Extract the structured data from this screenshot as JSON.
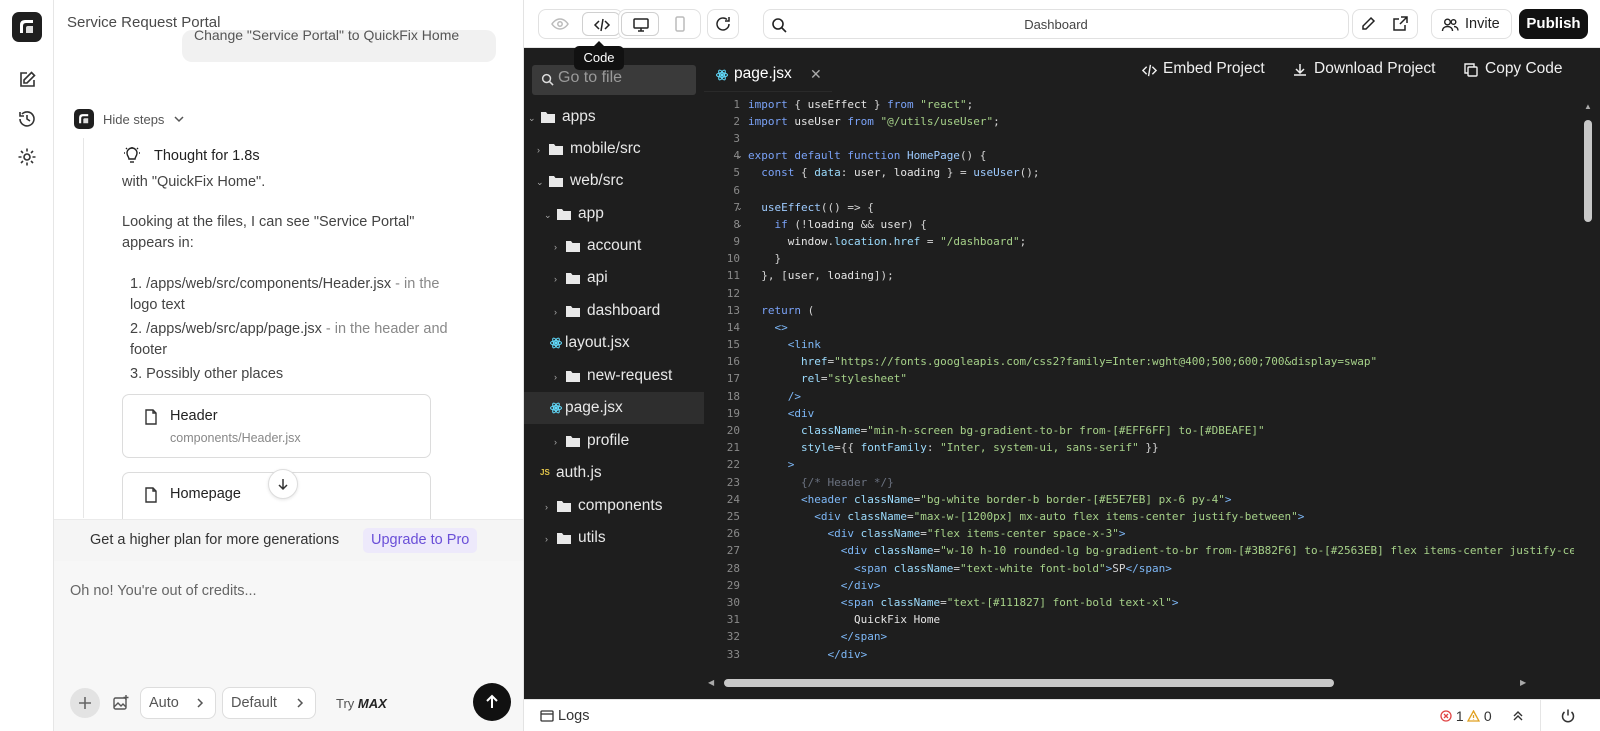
{
  "colors": {
    "accent": "#6a4fd8",
    "editor_bg": "#1e1e1e",
    "publish_bg": "#111111"
  },
  "rail": {
    "icons": [
      "logo-icon",
      "edit-icon",
      "history-icon",
      "gear-icon"
    ]
  },
  "chat": {
    "title": "Service Request Portal",
    "user_message": "Change \"Service Portal\" to QuickFix Home",
    "steps_toggle": "Hide steps",
    "thought": "Thought for 1.8s",
    "text1": "with \"QuickFix Home\".",
    "text2a": "Looking at the files, I can see \"Service Portal\"",
    "text2b": "appears in:",
    "item1a": "1. /apps/web/src/components/Header.jsx",
    "item1_dash": " - in the",
    "item1b": "logo text",
    "item2a": "2. /apps/web/src/app/page.jsx",
    "item2_dash": " - in the header and",
    "item2b": "footer",
    "item3": "3. Possibly other places",
    "files": [
      {
        "name": "Header",
        "path": "components/Header.jsx"
      },
      {
        "name": "Homepage",
        "path": ""
      }
    ],
    "upgrade_text": "Get a higher plan for more generations",
    "upgrade_button": "Upgrade to Pro",
    "composer_placeholder": "Oh no! You're out of credits...",
    "model_auto": "Auto",
    "model_default": "Default",
    "try_label": "Try",
    "try_max": "MAX"
  },
  "toolbar": {
    "tooltip": "Code",
    "url": "Dashboard",
    "invite": "Invite",
    "publish": "Publish"
  },
  "tree": {
    "search_placeholder": "Go to file",
    "nodes": [
      {
        "name": "apps"
      },
      {
        "name": "mobile/src"
      },
      {
        "name": "web/src"
      },
      {
        "name": "app"
      },
      {
        "name": "account"
      },
      {
        "name": "api"
      },
      {
        "name": "dashboard"
      },
      {
        "name": "layout.jsx"
      },
      {
        "name": "new-request"
      },
      {
        "name": "page.jsx"
      },
      {
        "name": "profile"
      },
      {
        "name": "auth.js"
      },
      {
        "name": "components"
      },
      {
        "name": "utils"
      }
    ]
  },
  "editor": {
    "tab": "page.jsx",
    "embed": "Embed Project",
    "download": "Download Project",
    "copy": "Copy Code",
    "line_numbers": [
      "1",
      "2",
      "3",
      "4",
      "5",
      "6",
      "7",
      "8",
      "9",
      "10",
      "11",
      "12",
      "13",
      "14",
      "15",
      "16",
      "17",
      "18",
      "19",
      "20",
      "21",
      "22",
      "23",
      "24",
      "25",
      "26",
      "27",
      "28",
      "29",
      "30",
      "31",
      "32",
      "33"
    ]
  },
  "bottombar": {
    "logs": "Logs",
    "errors": "1",
    "warnings": "0"
  }
}
